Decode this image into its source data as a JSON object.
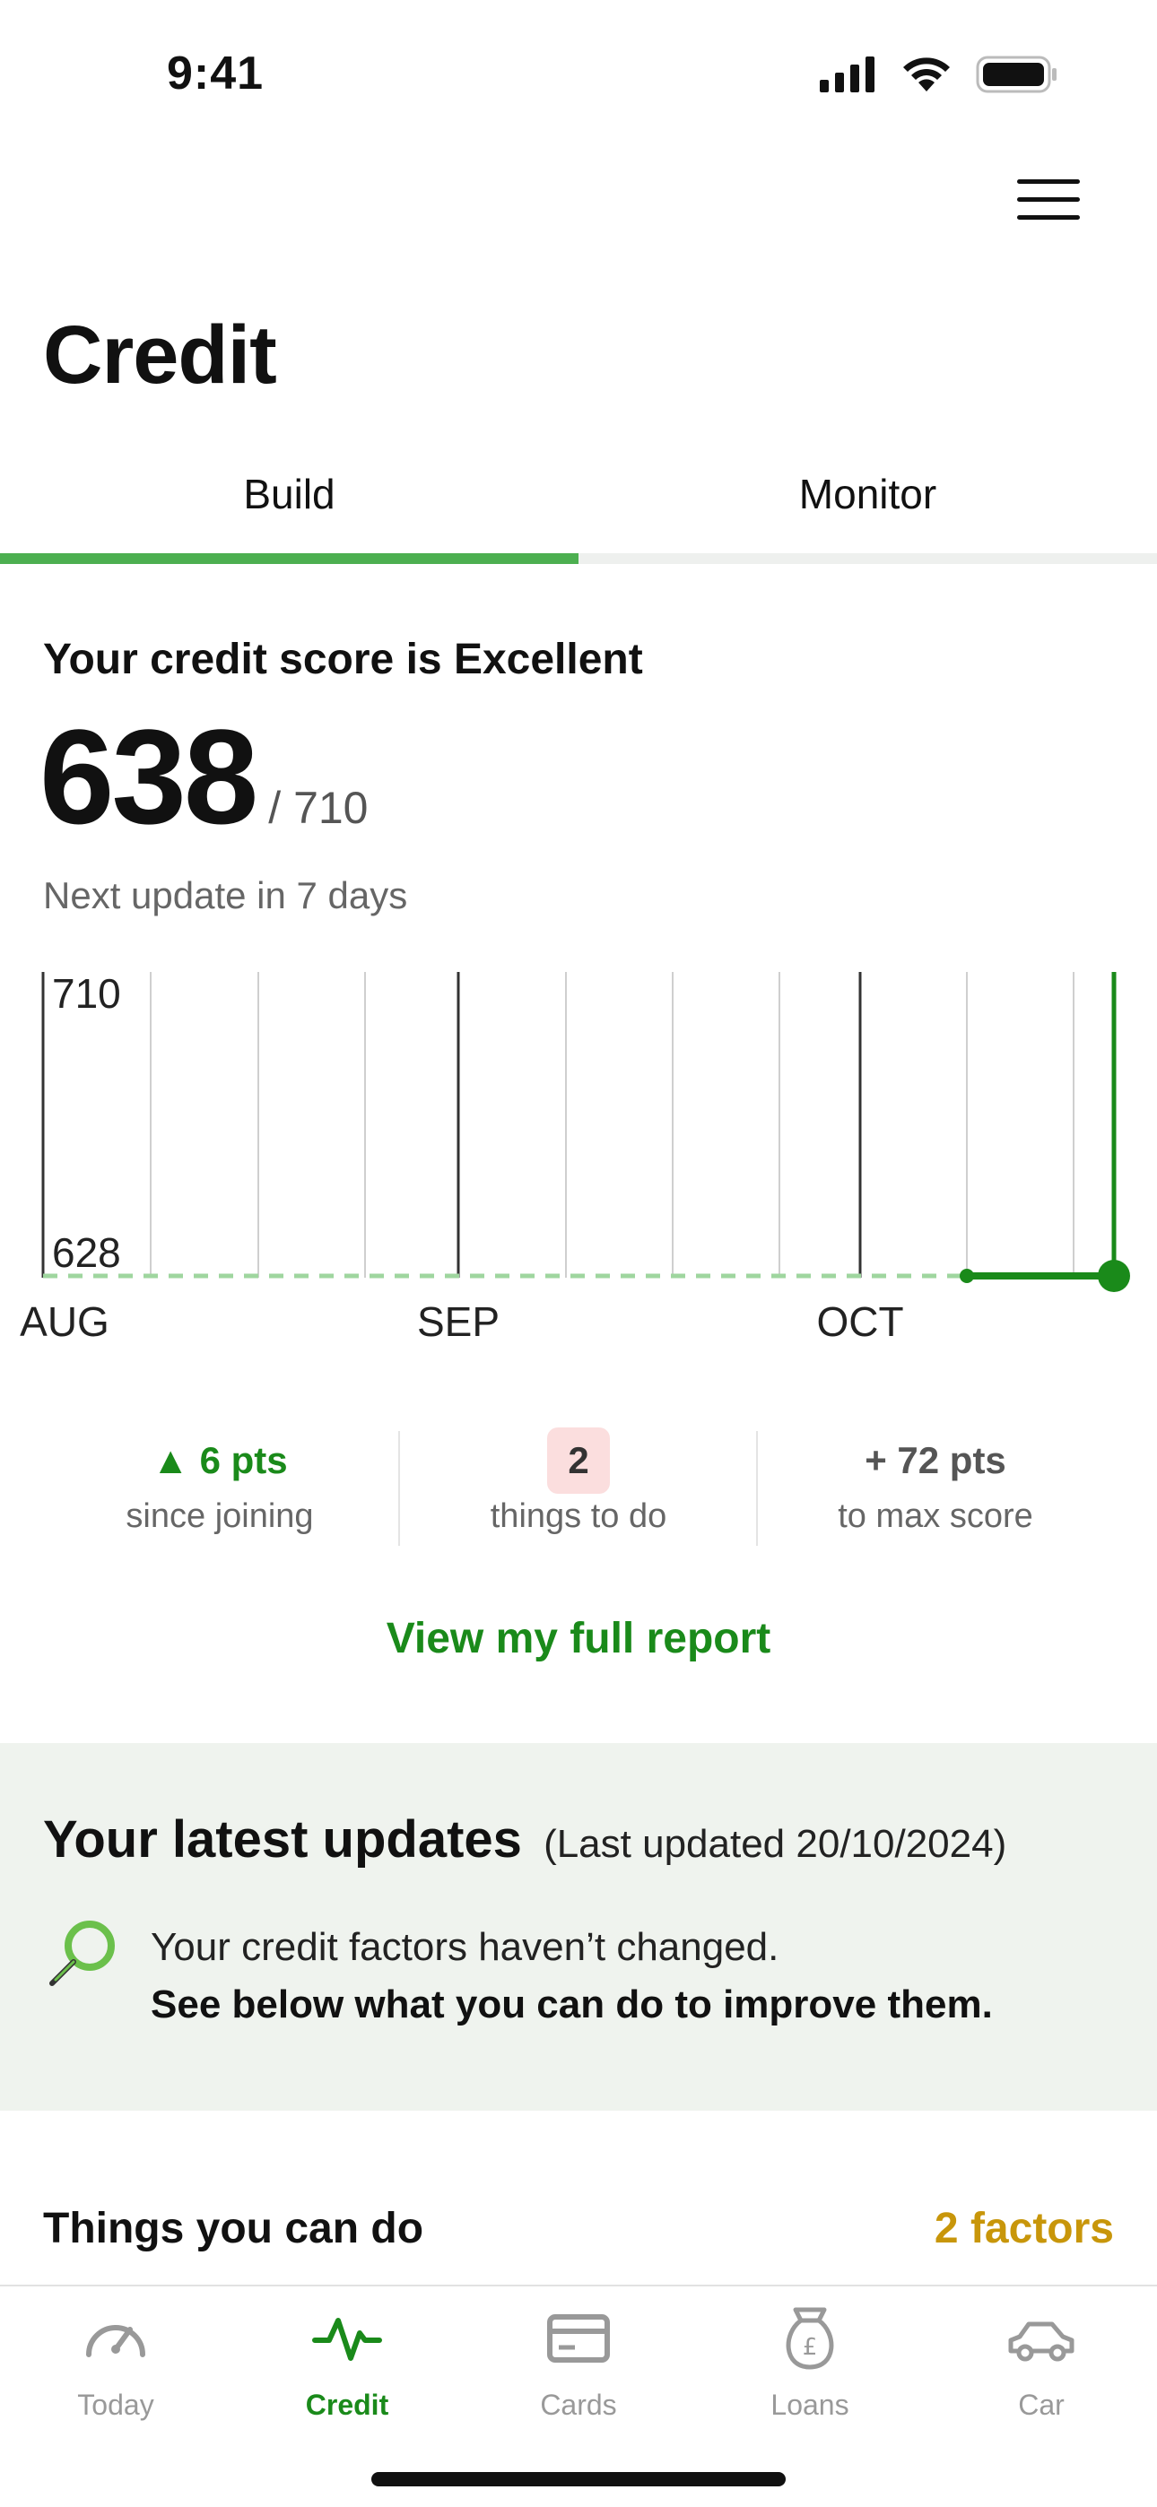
{
  "status_bar": {
    "time": "9:41"
  },
  "page": {
    "title": "Credit"
  },
  "tabs": [
    {
      "label": "Build",
      "active": true
    },
    {
      "label": "Monitor",
      "active": false
    }
  ],
  "score": {
    "heading": "Your credit score is Excellent",
    "value": "638",
    "max": "/ 710",
    "next_update": "Next update in 7 days"
  },
  "chart_data": {
    "type": "line",
    "y_top_label": "710",
    "y_bottom_label": "628",
    "x_labels": [
      "AUG",
      "SEP",
      "OCT"
    ],
    "baseline": 628,
    "ylim": [
      628,
      710
    ],
    "series": [
      {
        "values": [
          628,
          628
        ]
      }
    ],
    "colors": {
      "line": "#1a8a1a",
      "baseline_dash": "#9fd69f"
    }
  },
  "stats": [
    {
      "value": "▲ 6 pts",
      "label": "since joining"
    },
    {
      "value": "2",
      "label": "things to do"
    },
    {
      "value": "+ 72 pts",
      "label": "to max score"
    }
  ],
  "report_link": "View my full report",
  "updates": {
    "title": "Your latest updates",
    "date": "(Last updated 20/10/2024)",
    "line1": "Your credit factors haven’t changed.",
    "line2": "See below what you can do to improve them.",
    "icon": "magnifier-icon"
  },
  "things": {
    "title": "Things you can do",
    "count": "2 factors"
  },
  "nav": [
    {
      "label": "Today",
      "icon": "speedometer-icon",
      "active": false
    },
    {
      "label": "Credit",
      "icon": "pulse-icon",
      "active": true
    },
    {
      "label": "Cards",
      "icon": "card-icon",
      "active": false
    },
    {
      "label": "Loans",
      "icon": "money-bag-icon",
      "active": false
    },
    {
      "label": "Car",
      "icon": "car-icon",
      "active": false
    }
  ],
  "colors": {
    "accent": "#1a8a1a",
    "tab_indicator": "#4caf50",
    "factors": "#c8960a",
    "panel": "#eff3ee"
  }
}
